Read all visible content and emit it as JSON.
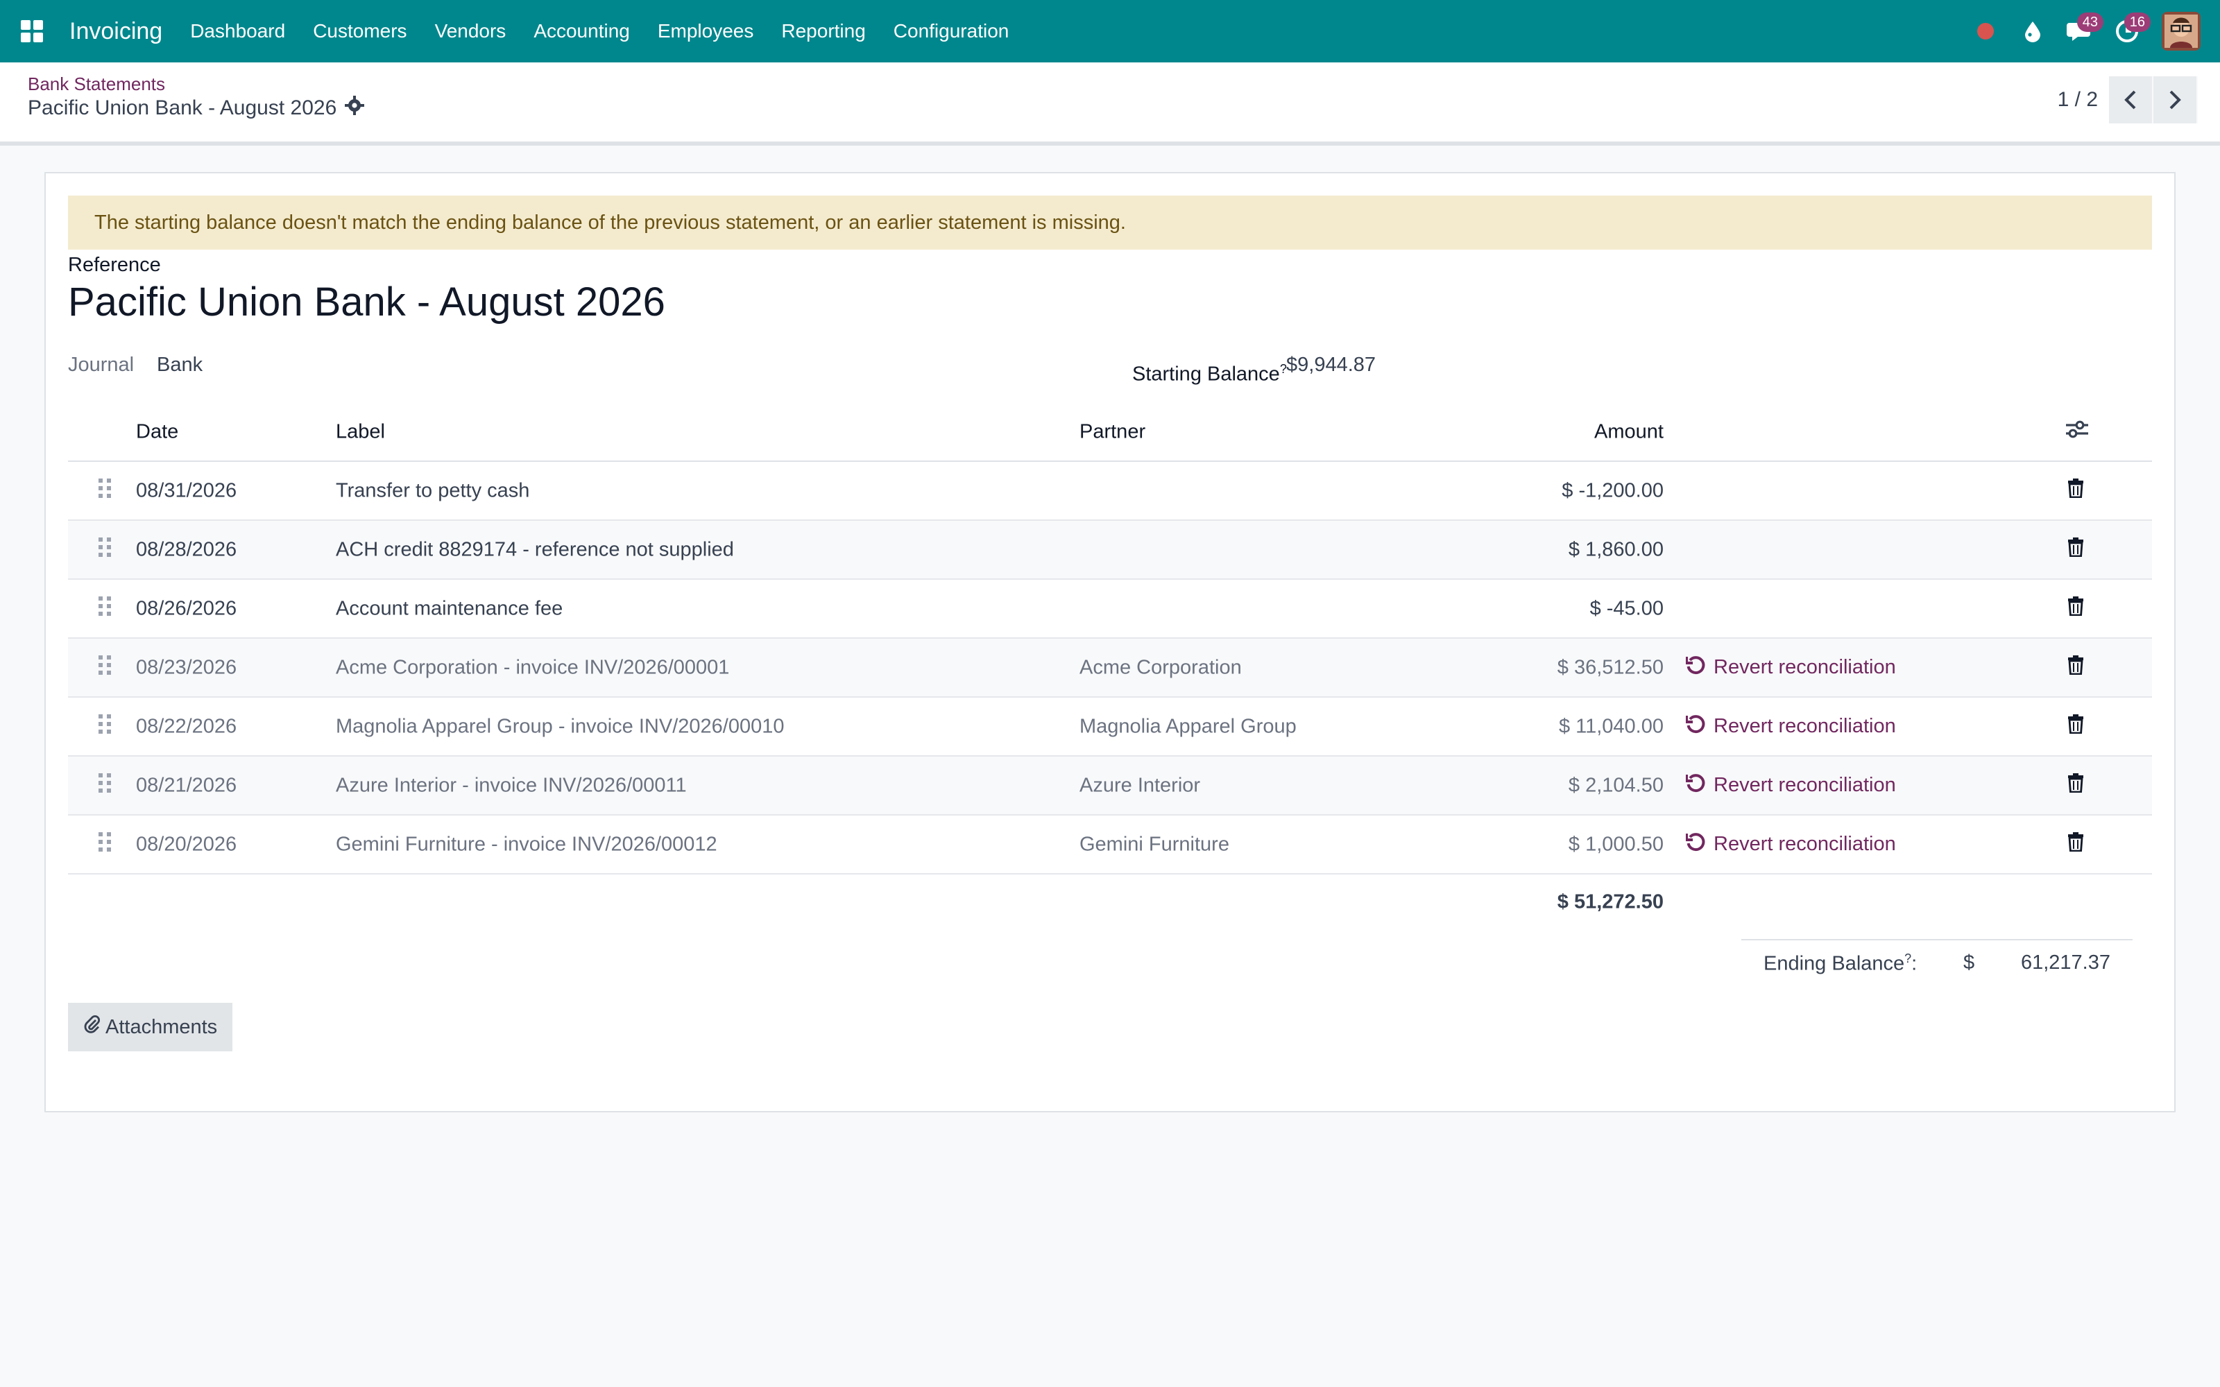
{
  "navbar": {
    "brand": "Invoicing",
    "menu": [
      "Dashboard",
      "Customers",
      "Vendors",
      "Accounting",
      "Employees",
      "Reporting",
      "Configuration"
    ],
    "messages_count": "43",
    "activities_count": "16",
    "colors": {
      "bar": "#00878d",
      "badge": "#9c3d77",
      "recording_dot": "#d9534f"
    }
  },
  "control_panel": {
    "breadcrumb": "Bank Statements",
    "title": "Pacific Union Bank - August 2026",
    "pager": "1 / 2"
  },
  "form": {
    "alert": "The starting balance doesn't match the ending balance of the previous statement, or an earlier statement is missing.",
    "reference_label": "Reference",
    "reference": "Pacific Union Bank - August 2026",
    "journal_label": "Journal",
    "journal": "Bank",
    "starting_balance_label": "Starting Balance",
    "starting_balance": "$9,944.87",
    "help_marker": "?",
    "columns": {
      "date": "Date",
      "label": "Label",
      "partner": "Partner",
      "amount": "Amount"
    },
    "lines": [
      {
        "date": "08/31/2026",
        "label": "Transfer to petty cash",
        "partner": "",
        "amount": "$ -1,200.00",
        "action": ""
      },
      {
        "date": "08/28/2026",
        "label": "ACH credit 8829174 - reference not supplied",
        "partner": "",
        "amount": "$ 1,860.00",
        "action": ""
      },
      {
        "date": "08/26/2026",
        "label": "Account maintenance fee",
        "partner": "",
        "amount": "$ -45.00",
        "action": ""
      },
      {
        "date": "08/23/2026",
        "label": "Acme Corporation - invoice INV/2026/00001",
        "partner": "Acme Corporation",
        "amount": "$ 36,512.50",
        "action": "Revert reconciliation"
      },
      {
        "date": "08/22/2026",
        "label": "Magnolia Apparel Group - invoice INV/2026/00010",
        "partner": "Magnolia Apparel Group",
        "amount": "$ 11,040.00",
        "action": "Revert reconciliation"
      },
      {
        "date": "08/21/2026",
        "label": "Azure Interior - invoice INV/2026/00011",
        "partner": "Azure Interior",
        "amount": "$ 2,104.50",
        "action": "Revert reconciliation"
      },
      {
        "date": "08/20/2026",
        "label": "Gemini Furniture - invoice INV/2026/00012",
        "partner": "Gemini Furniture",
        "amount": "$ 1,000.50",
        "action": "Revert reconciliation"
      }
    ],
    "total": "$ 51,272.50",
    "ending_balance_label": "Ending Balance",
    "ending_balance_suffix": ":",
    "ending_currency": "$",
    "ending_balance": "61,217.37",
    "attachments_label": "Attachments",
    "colors": {
      "alert_bg": "#f4ebcf",
      "alert_text": "#6a5212",
      "action_link": "#71275f"
    }
  }
}
